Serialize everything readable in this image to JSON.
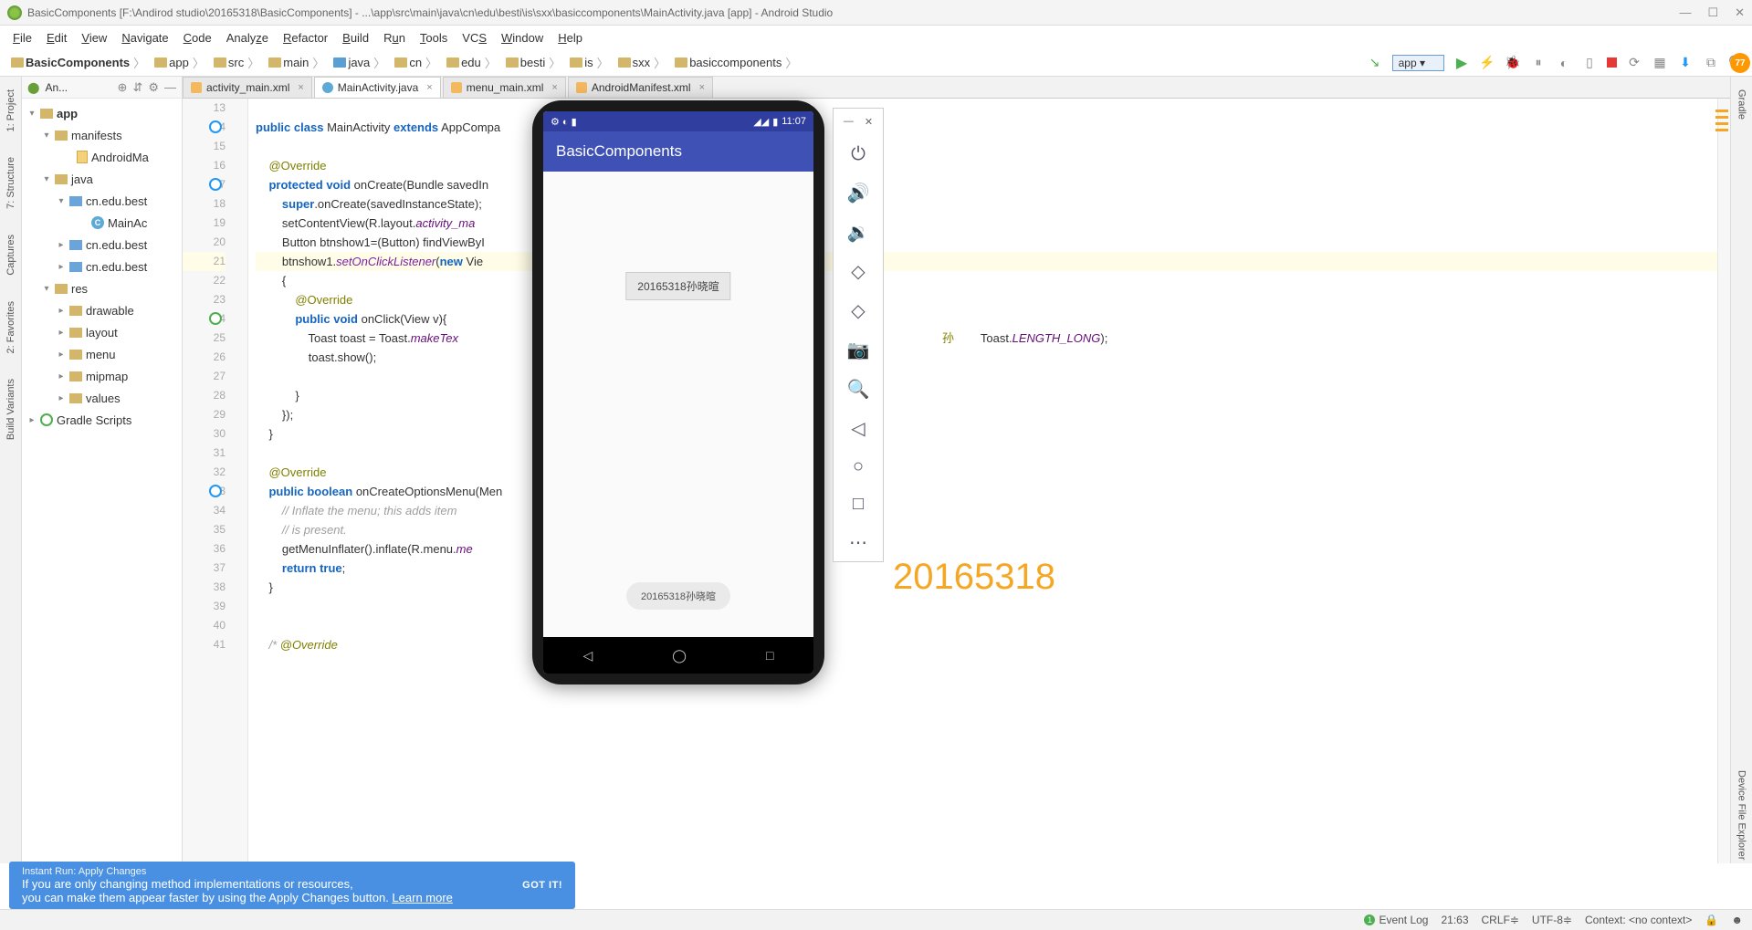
{
  "title": "BasicComponents [F:\\Andirod studio\\20165318\\BasicComponents] - ...\\app\\src\\main\\java\\cn\\edu\\besti\\is\\sxx\\basiccomponents\\MainActivity.java [app] - Android Studio",
  "menu": [
    "File",
    "Edit",
    "View",
    "Navigate",
    "Code",
    "Analyze",
    "Refactor",
    "Build",
    "Run",
    "Tools",
    "VCS",
    "Window",
    "Help"
  ],
  "crumbs": [
    "BasicComponents",
    "app",
    "src",
    "main",
    "java",
    "cn",
    "edu",
    "besti",
    "is",
    "sxx",
    "basiccomponents"
  ],
  "run_config": "app",
  "left_tabs": [
    "1: Project",
    "7: Structure",
    "Captures",
    "2: Favorites",
    "Build Variants"
  ],
  "right_tabs": [
    "Gradle",
    "Device File Explorer"
  ],
  "panel": {
    "title": "An..."
  },
  "tree": {
    "app": "app",
    "manifests": "manifests",
    "manifest_file": "AndroidMa",
    "java": "java",
    "pkg1": "cn.edu.best",
    "mainact": "MainAc",
    "pkg2": "cn.edu.best",
    "pkg3": "cn.edu.best",
    "res": "res",
    "drawable": "drawable",
    "layout": "layout",
    "menu_f": "menu",
    "mipmap": "mipmap",
    "values": "values",
    "gradle": "Gradle Scripts"
  },
  "tabs": [
    {
      "label": "activity_main.xml",
      "type": "xml",
      "active": false
    },
    {
      "label": "MainActivity.java",
      "type": "java",
      "active": true
    },
    {
      "label": "menu_main.xml",
      "type": "xml",
      "active": false
    },
    {
      "label": "AndroidManifest.xml",
      "type": "xml",
      "active": false
    }
  ],
  "code": {
    "l13": "",
    "l14": "public class MainActivity extends AppCompa",
    "l15": "",
    "l16": "    @Override",
    "l17": "    protected void onCreate(Bundle savedIn",
    "l18": "        super.onCreate(savedInstanceState);",
    "l19": "        setContentView(R.layout.activity_ma",
    "l20": "        Button btnshow1=(Button) findViewByI",
    "l21": "        btnshow1.setOnClickListener(new Vie",
    "l22": "        {",
    "l23": "            @Override",
    "l24": "            public void onClick(View v){",
    "l25": "                Toast toast = Toast.makeTex",
    "l25b": "Toast.LENGTH_LONG);",
    "l26": "                toast.show();",
    "l27": "",
    "l28": "            }",
    "l29": "        });",
    "l30": "    }",
    "l31": "",
    "l32": "    @Override",
    "l33": "    public boolean onCreateOptionsMenu(Men",
    "l34": "        // Inflate the menu; this adds item",
    "l35": "        // is present.",
    "l36": "        getMenuInflater().inflate(R.menu.me",
    "l37": "        return true;",
    "l38": "    }",
    "l39": "",
    "l40": "",
    "l41": "    /* @Override"
  },
  "line_start": 13,
  "line_end": 41,
  "emulator": {
    "time": "11:07",
    "app_title": "BasicComponents",
    "button_text": "20165318孙晓暄",
    "toast_text": "20165318孙晓暄"
  },
  "watermark": "20165318",
  "banner": {
    "title": "Instant Run: Apply Changes",
    "line1": "If you are only changing method implementations or resources,",
    "line2": "you can make them appear faster by using the Apply Changes button. ",
    "learn": "Learn more",
    "gotit": "GOT IT!"
  },
  "status": {
    "event_log": "Event Log",
    "event_count": "1",
    "pos": "21:63",
    "crlf": "CRLF",
    "enc": "UTF-8",
    "context": "Context: <no context>"
  },
  "gauge": "77"
}
